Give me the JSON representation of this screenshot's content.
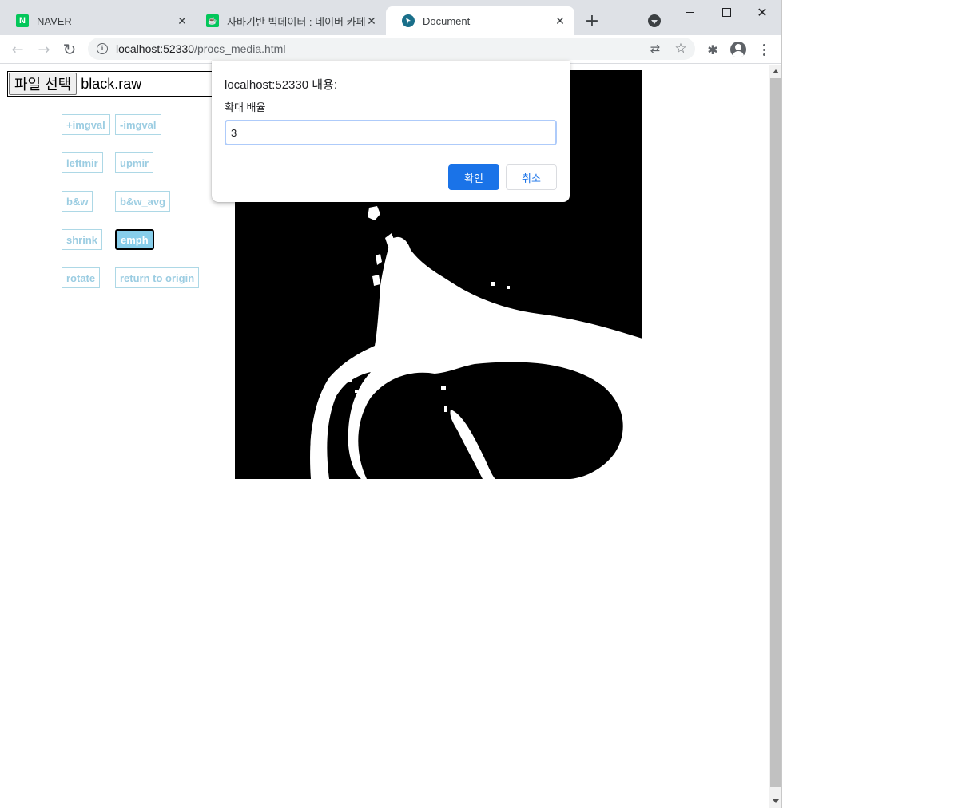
{
  "tabs": [
    {
      "title": "NAVER",
      "favicon_letter": "N",
      "favicon_color": "#03c75a"
    },
    {
      "title": "자바기반 빅데이터 : 네이버 카페",
      "favicon_letter": "☕",
      "favicon_color": "#03c75a"
    },
    {
      "title": "Document",
      "favicon_color": "#1a6f8a",
      "active": true
    }
  ],
  "tab_close_glyph": "✕",
  "new_tab_glyph": "+",
  "window_controls": {
    "close_glyph": "✕"
  },
  "toolbar": {
    "back_glyph": "←",
    "forward_glyph": "→",
    "reload_glyph": "↻",
    "url_host": "localhost:52330",
    "url_path": "/procs_media.html",
    "info_glyph": "i",
    "translate_glyph": "⇄",
    "star_glyph": "☆",
    "extensions_glyph": "✱"
  },
  "file_input": {
    "button_label": "파일 선택",
    "file_name": "black.raw"
  },
  "ops": {
    "plus_imgval": "+imgval",
    "minus_imgval": "-imgval",
    "leftmir": "leftmir",
    "upmir": "upmir",
    "bw": "b&w",
    "bw_avg": "b&w_avg",
    "shrink": "shrink",
    "emph": "emph",
    "rotate": "rotate",
    "return_origin": "return to origin"
  },
  "dialog": {
    "title": "localhost:52330 내용:",
    "message": "확대 배율",
    "input_value": "3",
    "ok_label": "확인",
    "cancel_label": "취소"
  },
  "colors": {
    "accent": "#1a73e8",
    "op_button_border": "#add8e6",
    "op_button_active_bg": "#87ceeb"
  },
  "icons": [
    "naver-icon",
    "cafe-icon",
    "document-icon",
    "tab-search-icon",
    "info-icon",
    "translate-icon",
    "star-icon",
    "extensions-icon",
    "profile-icon",
    "menu-icon"
  ]
}
